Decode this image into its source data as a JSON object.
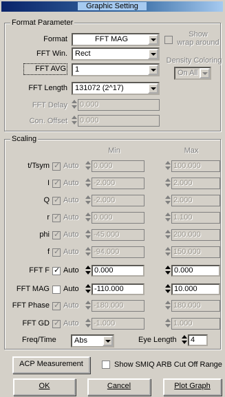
{
  "window": {
    "title": "Graphic Setting"
  },
  "format_parameter": {
    "group_label": "Format Parameter",
    "format": {
      "label": "Format",
      "value": "FFT MAG"
    },
    "fft_win": {
      "label": "FFT Win.",
      "value": "Rect"
    },
    "fft_avg": {
      "label": "FFT AVG",
      "value": "1"
    },
    "fft_length": {
      "label": "FFT Length",
      "value": "131072 (2^17)"
    },
    "fft_delay": {
      "label": "FFT Delay",
      "value": "0.000"
    },
    "con_offset": {
      "label": "Con. Offset",
      "value": "0.000"
    },
    "show_wrap_around": {
      "label_line1": "Show",
      "label_line2": "wrap around",
      "checked": false
    },
    "density_coloring": {
      "label": "Density Coloring",
      "value": "On All"
    }
  },
  "scaling": {
    "group_label": "Scaling",
    "col_min": "Min",
    "col_max": "Max",
    "auto_label": "Auto",
    "rows": [
      {
        "label": "t/Tsym",
        "auto": true,
        "enabled": false,
        "min": "0.000",
        "max": "100.000"
      },
      {
        "label": "I",
        "auto": true,
        "enabled": false,
        "min": "-2.000",
        "max": "2.000"
      },
      {
        "label": "Q",
        "auto": true,
        "enabled": false,
        "min": "-2.000",
        "max": "2.000"
      },
      {
        "label": "r",
        "auto": true,
        "enabled": false,
        "min": "0.000",
        "max": "1.100"
      },
      {
        "label": "phi",
        "auto": true,
        "enabled": false,
        "min": "-45.000",
        "max": "200.000"
      },
      {
        "label": "f",
        "auto": true,
        "enabled": false,
        "min": "-94.000",
        "max": "150.000"
      },
      {
        "label": "FFT F",
        "auto": true,
        "enabled": true,
        "min": "0.000",
        "max": "0.000"
      },
      {
        "label": "FFT MAG",
        "auto": false,
        "enabled": true,
        "min": "-110.000",
        "max": "10.000"
      },
      {
        "label": "FFT Phase",
        "auto": true,
        "enabled": false,
        "min": "-180.000",
        "max": "180.000"
      },
      {
        "label": "FFT GD",
        "auto": true,
        "enabled": false,
        "min": "-1.000",
        "max": "1.000"
      }
    ],
    "freq_time": {
      "label": "Freq/Time",
      "value": "Abs"
    },
    "eye_length": {
      "label": "Eye Length",
      "value": "4"
    }
  },
  "bottom": {
    "acp_button": "ACP Measurement",
    "show_smiq": {
      "label": "Show SMIQ ARB Cut Off Range",
      "checked": false
    },
    "ok": "OK",
    "cancel": "Cancel",
    "plot_graph": "Plot Graph"
  }
}
